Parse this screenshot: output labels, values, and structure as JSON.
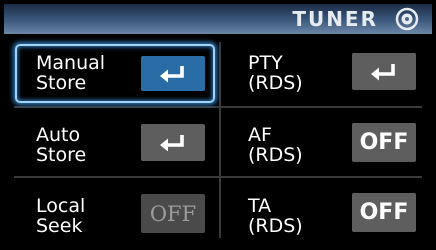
{
  "header": {
    "title": "TUNER",
    "icon": "disc-icon"
  },
  "items": [
    {
      "line1": "Manual",
      "line2": "Store",
      "button": {
        "type": "icon",
        "icon": "enter-arrow-icon"
      },
      "selected": true
    },
    {
      "line1": "PTY",
      "line2": "(RDS)",
      "button": {
        "type": "icon",
        "icon": "enter-arrow-icon"
      }
    },
    {
      "line1": "Auto",
      "line2": "Store",
      "button": {
        "type": "icon",
        "icon": "enter-arrow-icon"
      }
    },
    {
      "line1": "AF",
      "line2": "(RDS)",
      "button": {
        "type": "text",
        "text": "OFF"
      }
    },
    {
      "line1": "Local",
      "line2": "Seek",
      "button": {
        "type": "text",
        "text": "OFF",
        "disabled": true
      }
    },
    {
      "line1": "TA",
      "line2": "(RDS)",
      "button": {
        "type": "text",
        "text": "OFF"
      }
    }
  ],
  "colors": {
    "selected_button": "#2a6da6",
    "focus_ring": "#9fd2f3",
    "button": "#5e5e5e"
  }
}
